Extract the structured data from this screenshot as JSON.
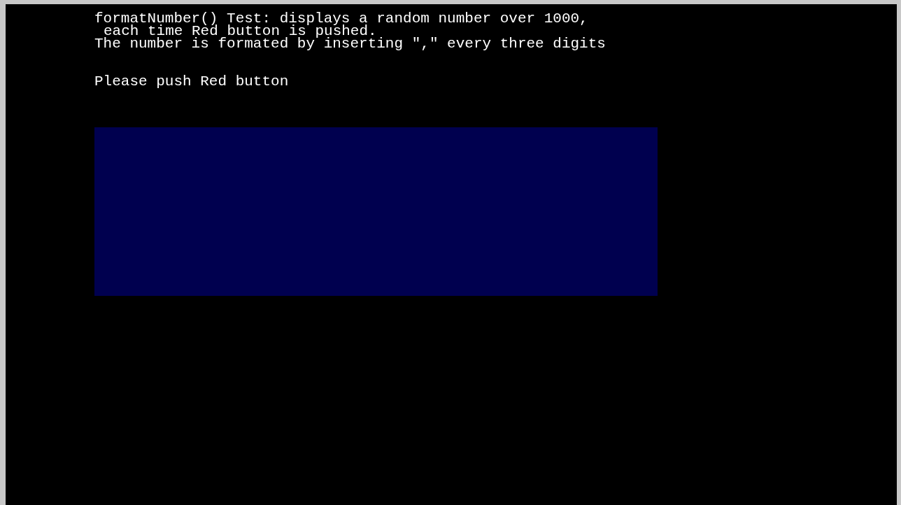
{
  "description": {
    "lines": [
      {
        "text": "formatNumber() Test: displays a random number over 1000,",
        "indented": false
      },
      {
        "text": "each time Red button is pushed.",
        "indented": true
      },
      {
        "text": "The number is formated by inserting \",\" every three digits",
        "indented": false
      }
    ]
  },
  "prompt": "Please push Red button",
  "display": {
    "color": "#00004f"
  }
}
